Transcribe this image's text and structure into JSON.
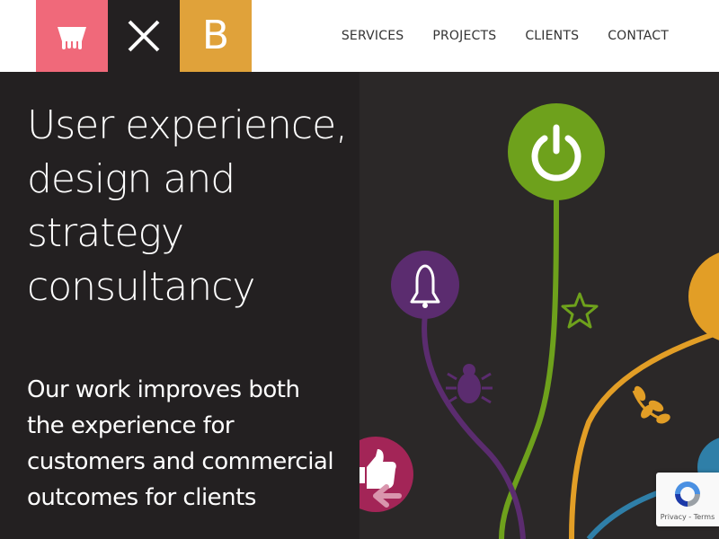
{
  "brand": {
    "logo_letter": "B",
    "colors": {
      "pink": "#f0697a",
      "dark": "#232021",
      "orange": "#e0a23a"
    }
  },
  "nav": {
    "items": [
      "SERVICES",
      "PROJECTS",
      "CLIENTS",
      "CONTACT"
    ]
  },
  "hero": {
    "title": "User experience, design and strategy consultancy",
    "subtitle": "Our work improves both the experience for customers and commercial outcomes for clients",
    "illustration_icons": [
      "power-icon",
      "bell-icon",
      "star-icon",
      "bug-icon",
      "leaf-icon",
      "thumbs-up-icon",
      "arrow-left-icon"
    ],
    "colors": {
      "green": "#6ea11c",
      "purple": "#5b2c6f",
      "orange": "#e29e26",
      "blue": "#2f7fa8",
      "magenta": "#a32557"
    }
  },
  "recaptcha": {
    "links": "Privacy - Terms"
  }
}
